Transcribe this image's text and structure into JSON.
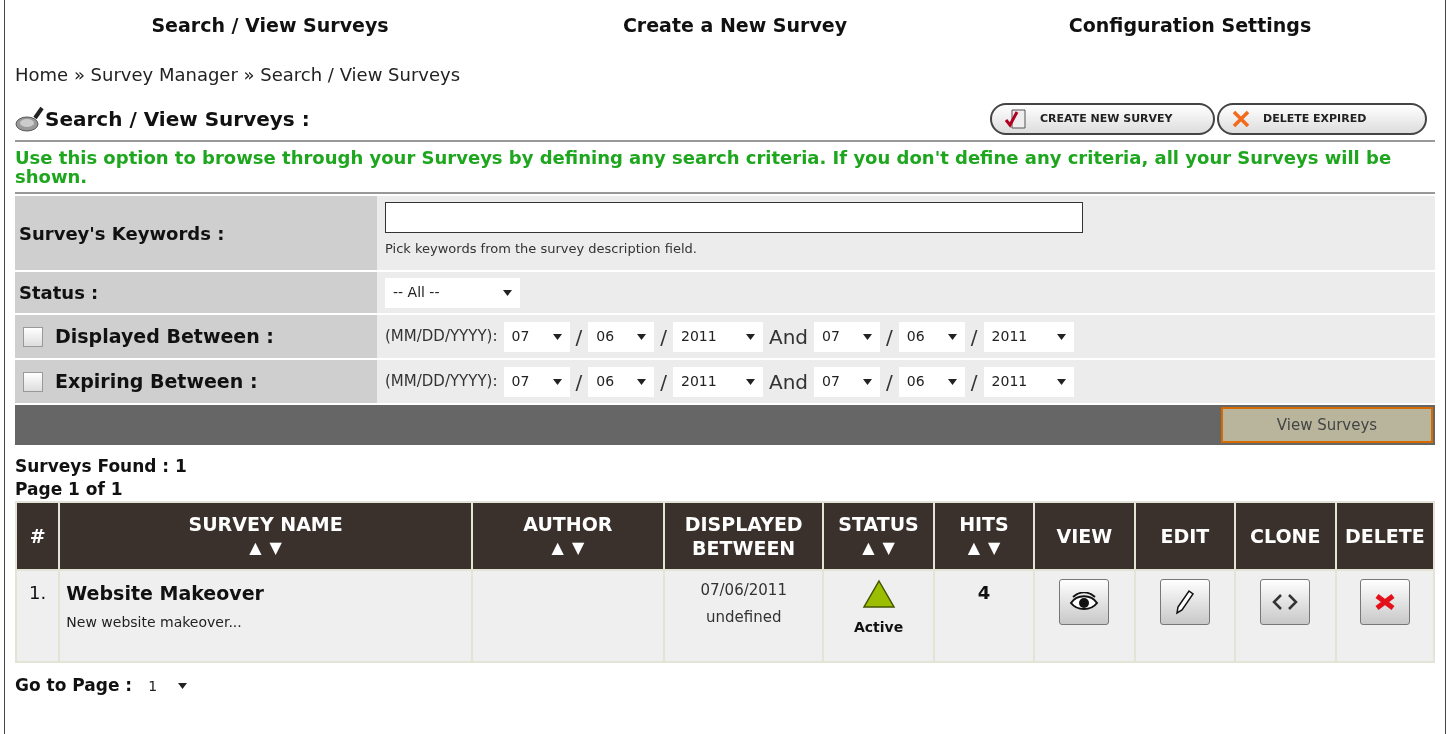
{
  "nav": [
    {
      "label": "Search / View Surveys"
    },
    {
      "label": "Create a New Survey"
    },
    {
      "label": "Configuration Settings"
    }
  ],
  "breadcrumb": "Home » Survey Manager » Search / View Surveys",
  "title": "Search / View Surveys :",
  "actions": [
    {
      "kind": "create",
      "label": "CREATE NEW SURVEY"
    },
    {
      "kind": "delete",
      "label": "DELETE EXPIRED"
    }
  ],
  "intro": "Use this option to browse through your Surveys by defining any search criteria. If you don't define any criteria, all your Surveys will be shown.",
  "form": {
    "keywords": {
      "label": "Survey's Keywords :",
      "hint": "Pick keywords from the survey description field."
    },
    "status": {
      "label": "Status :",
      "value": "-- All --"
    },
    "ranges": [
      {
        "label": "Displayed Between :",
        "checked": false,
        "format": "(MM/DD/YYYY):",
        "separator": "/",
        "from": [
          "07",
          "06",
          "2011"
        ],
        "and": "And",
        "to": [
          "07",
          "06",
          "2011"
        ]
      },
      {
        "label": "Expiring Between :",
        "checked": false,
        "format": "(MM/DD/YYYY):",
        "separator": "/",
        "from": [
          "07",
          "06",
          "2011"
        ],
        "and": "And",
        "to": [
          "07",
          "06",
          "2011"
        ]
      }
    ],
    "submit": "View Surveys"
  },
  "found": "Surveys Found : 1",
  "page": "Page 1 of 1",
  "table": {
    "columns": [
      {
        "label": "#",
        "sortable": false
      },
      {
        "label": "SURVEY NAME",
        "sortable": true
      },
      {
        "label": "AUTHOR",
        "sortable": true
      },
      {
        "label": "DISPLAYED BETWEEN",
        "sortable": false
      },
      {
        "label": "STATUS",
        "sortable": true
      },
      {
        "label": "HITS",
        "sortable": true
      },
      {
        "label": "VIEW",
        "sortable": false
      },
      {
        "label": "EDIT",
        "sortable": false
      },
      {
        "label": "CLONE",
        "sortable": false
      },
      {
        "label": "DELETE",
        "sortable": false
      }
    ],
    "sort_up": "▲",
    "sort_down": "▼",
    "rows": [
      {
        "index": "1.",
        "name": "Website Makeover",
        "description": "New website makeover...",
        "from": "07/06/2011",
        "to": "undefined",
        "status": "Active",
        "hits": "4"
      }
    ]
  },
  "goto": {
    "label": "Go to Page :",
    "value": "1"
  }
}
